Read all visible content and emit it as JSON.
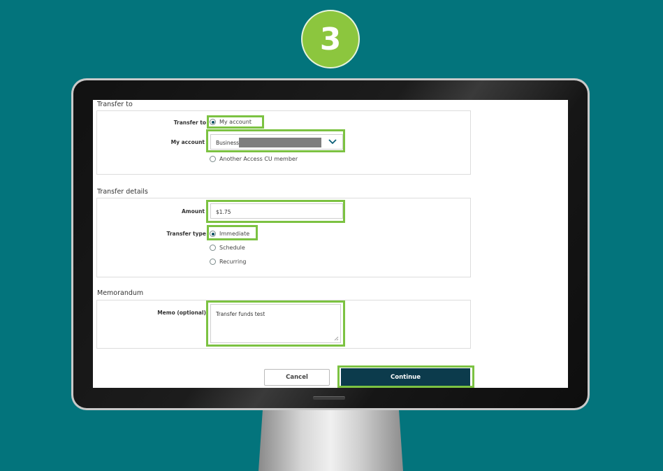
{
  "step": {
    "number": "3"
  },
  "transfer_to": {
    "section_title": "Transfer to",
    "label": "Transfer to",
    "option_my_account": "My account",
    "my_account_label": "My account",
    "my_account_value": "Business",
    "option_other_member": "Another Access CU member"
  },
  "transfer_details": {
    "section_title": "Transfer details",
    "amount_label": "Amount",
    "amount_value": "$1.75",
    "type_label": "Transfer type",
    "options": [
      "Immediate",
      "Schedule",
      "Recurring"
    ],
    "selected": "Immediate"
  },
  "memorandum": {
    "section_title": "Memorandum",
    "memo_label": "Memo (optional)",
    "memo_value": "Transfer funds test"
  },
  "actions": {
    "cancel": "Cancel",
    "continue": "Continue"
  },
  "colors": {
    "background": "#03747c",
    "highlight": "#7cc242",
    "badge": "#8cc63e",
    "primary_button": "#0c3b4c"
  },
  "icons": {
    "dropdown": "chevron-down-icon"
  }
}
